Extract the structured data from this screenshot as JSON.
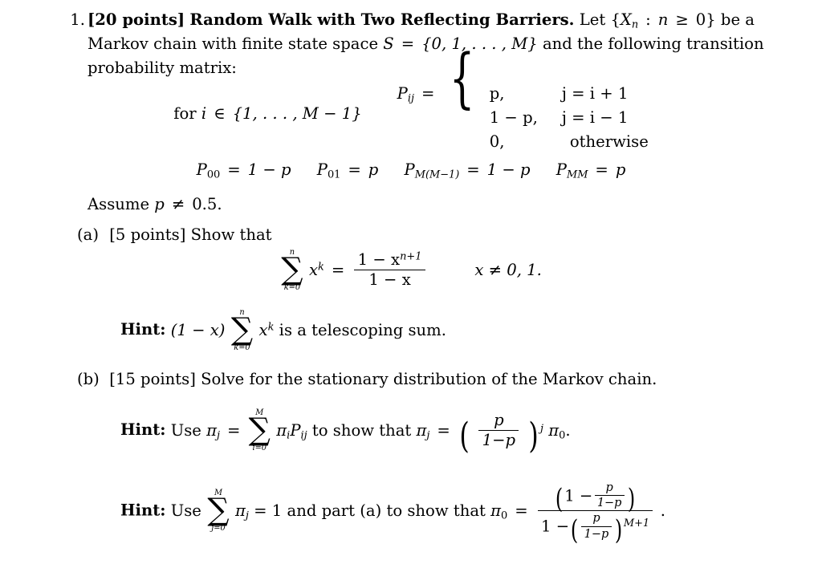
{
  "document": {
    "type": "homework-problem",
    "problem_number": "1.",
    "points_label": "[20 points]",
    "title": "Random Walk with Two Reflecting Barriers.",
    "intro_part1": "Let {",
    "intro_X": "X",
    "intro_X_sub": "n",
    "intro_colon": ":",
    "intro_n": "n",
    "intro_ge": "≥",
    "intro_zero": "0",
    "intro_part2": "} be a Markov chain with finite state space",
    "state_space_S": "S",
    "state_space_eq": "=",
    "state_space_set": "{0, 1, . . . , M}",
    "intro_part3": "and the following transition probability matrix:",
    "line1_text_a": "Let",
    "line1_text_b": "be a",
    "line2_text_a": "Markov chain with finite state space",
    "line2_text_b": "and the following transition probability",
    "line3_text": "matrix:"
  },
  "cases": {
    "for_text": "for",
    "for_i": "i",
    "for_in": "∈",
    "for_set": "{1, . . . , M − 1}",
    "P_symbol": "P",
    "P_sub": "ij",
    "equals": "=",
    "rows": [
      {
        "value": "p,",
        "condition": "j = i + 1"
      },
      {
        "value": "1 − p,",
        "condition": "j = i − 1"
      },
      {
        "value": "0,",
        "condition": "otherwise"
      }
    ]
  },
  "boundary": {
    "items": [
      {
        "lhs": "P",
        "sub": "00",
        "rhs": "1 − p"
      },
      {
        "lhs": "P",
        "sub": "01",
        "rhs": "p"
      },
      {
        "lhs": "P",
        "sub": "M(M−1)",
        "rhs": "1 − p"
      },
      {
        "lhs": "P",
        "sub": "MM",
        "rhs": "p"
      }
    ],
    "equals": "="
  },
  "assume": {
    "text": "Assume",
    "var": "p",
    "neq": "≠",
    "value": "0.5."
  },
  "part_a": {
    "label": "(a)",
    "points": "[5 points]",
    "text": "Show that",
    "equation": {
      "sum_top": "n",
      "sum_bottom": "k=0",
      "sum_sigma": "∑",
      "summand_base": "x",
      "summand_exp": "k",
      "equals": "=",
      "numerator": "1 − x",
      "numerator_exp": "n+1",
      "denominator": "1 − x",
      "condition": "x ≠ 0, 1."
    },
    "hint": {
      "label": "Hint:",
      "prefix": "(1 − x)",
      "sum_top": "n",
      "sum_bottom": "k=0",
      "sum_sigma": "∑",
      "summand_base": "x",
      "summand_exp": "k",
      "suffix": "is a telescoping sum."
    }
  },
  "part_b": {
    "label": "(b)",
    "points": "[15 points]",
    "text": "Solve for the stationary distribution of the Markov chain.",
    "hint1": {
      "label": "Hint:",
      "use": "Use",
      "pi": "π",
      "pi_sub_j": "j",
      "equals": "=",
      "sum_top": "M",
      "sum_bottom": "i=0",
      "sum_sigma": "∑",
      "summand_pi": "π",
      "summand_pi_sub": "i",
      "summand_P": "P",
      "summand_P_sub": "ij",
      "to_show": "to show that",
      "result_pi": "π",
      "result_pi_sub": "j",
      "result_eq": "=",
      "frac_num": "p",
      "frac_den": "1−p",
      "exponent": "j",
      "trailing_pi": "π",
      "trailing_pi_sub": "0",
      "period": "."
    },
    "hint2": {
      "label": "Hint:",
      "use": "Use",
      "sum_top": "M",
      "sum_bottom": "j=0",
      "sum_sigma": "∑",
      "summand_pi": "π",
      "summand_pi_sub": "j",
      "equals_one": "= 1",
      "and_part": "and part (a) to show that",
      "result_pi": "π",
      "result_pi_sub": "0",
      "result_eq": "=",
      "num_one": "1 −",
      "num_frac_num": "p",
      "num_frac_den": "1−p",
      "den_one": "1 −",
      "den_frac_num": "p",
      "den_frac_den": "1−p",
      "den_exponent": "M+1",
      "period": "."
    }
  },
  "colors": {
    "text": "#000000",
    "background": "#ffffff"
  }
}
